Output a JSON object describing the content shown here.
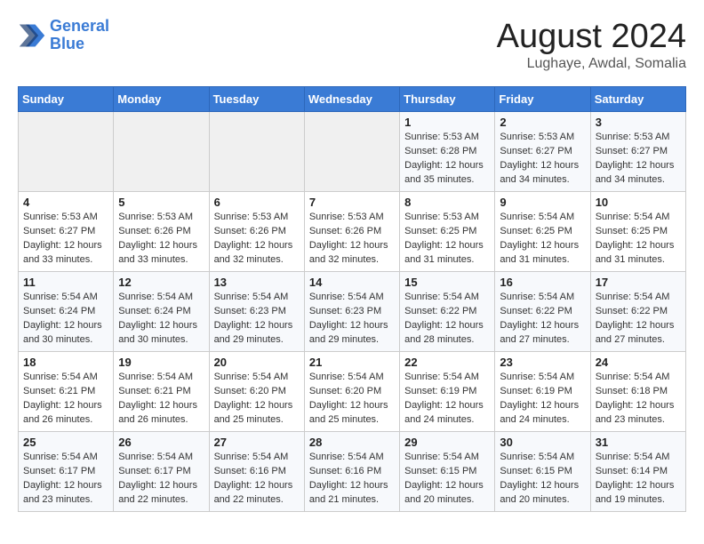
{
  "header": {
    "logo_line1": "General",
    "logo_line2": "Blue",
    "month_year": "August 2024",
    "location": "Lughaye, Awdal, Somalia"
  },
  "days_of_week": [
    "Sunday",
    "Monday",
    "Tuesday",
    "Wednesday",
    "Thursday",
    "Friday",
    "Saturday"
  ],
  "weeks": [
    [
      {
        "day": "",
        "info": ""
      },
      {
        "day": "",
        "info": ""
      },
      {
        "day": "",
        "info": ""
      },
      {
        "day": "",
        "info": ""
      },
      {
        "day": "1",
        "info": "Sunrise: 5:53 AM\nSunset: 6:28 PM\nDaylight: 12 hours\nand 35 minutes."
      },
      {
        "day": "2",
        "info": "Sunrise: 5:53 AM\nSunset: 6:27 PM\nDaylight: 12 hours\nand 34 minutes."
      },
      {
        "day": "3",
        "info": "Sunrise: 5:53 AM\nSunset: 6:27 PM\nDaylight: 12 hours\nand 34 minutes."
      }
    ],
    [
      {
        "day": "4",
        "info": "Sunrise: 5:53 AM\nSunset: 6:27 PM\nDaylight: 12 hours\nand 33 minutes."
      },
      {
        "day": "5",
        "info": "Sunrise: 5:53 AM\nSunset: 6:26 PM\nDaylight: 12 hours\nand 33 minutes."
      },
      {
        "day": "6",
        "info": "Sunrise: 5:53 AM\nSunset: 6:26 PM\nDaylight: 12 hours\nand 32 minutes."
      },
      {
        "day": "7",
        "info": "Sunrise: 5:53 AM\nSunset: 6:26 PM\nDaylight: 12 hours\nand 32 minutes."
      },
      {
        "day": "8",
        "info": "Sunrise: 5:53 AM\nSunset: 6:25 PM\nDaylight: 12 hours\nand 31 minutes."
      },
      {
        "day": "9",
        "info": "Sunrise: 5:54 AM\nSunset: 6:25 PM\nDaylight: 12 hours\nand 31 minutes."
      },
      {
        "day": "10",
        "info": "Sunrise: 5:54 AM\nSunset: 6:25 PM\nDaylight: 12 hours\nand 31 minutes."
      }
    ],
    [
      {
        "day": "11",
        "info": "Sunrise: 5:54 AM\nSunset: 6:24 PM\nDaylight: 12 hours\nand 30 minutes."
      },
      {
        "day": "12",
        "info": "Sunrise: 5:54 AM\nSunset: 6:24 PM\nDaylight: 12 hours\nand 30 minutes."
      },
      {
        "day": "13",
        "info": "Sunrise: 5:54 AM\nSunset: 6:23 PM\nDaylight: 12 hours\nand 29 minutes."
      },
      {
        "day": "14",
        "info": "Sunrise: 5:54 AM\nSunset: 6:23 PM\nDaylight: 12 hours\nand 29 minutes."
      },
      {
        "day": "15",
        "info": "Sunrise: 5:54 AM\nSunset: 6:22 PM\nDaylight: 12 hours\nand 28 minutes."
      },
      {
        "day": "16",
        "info": "Sunrise: 5:54 AM\nSunset: 6:22 PM\nDaylight: 12 hours\nand 27 minutes."
      },
      {
        "day": "17",
        "info": "Sunrise: 5:54 AM\nSunset: 6:22 PM\nDaylight: 12 hours\nand 27 minutes."
      }
    ],
    [
      {
        "day": "18",
        "info": "Sunrise: 5:54 AM\nSunset: 6:21 PM\nDaylight: 12 hours\nand 26 minutes."
      },
      {
        "day": "19",
        "info": "Sunrise: 5:54 AM\nSunset: 6:21 PM\nDaylight: 12 hours\nand 26 minutes."
      },
      {
        "day": "20",
        "info": "Sunrise: 5:54 AM\nSunset: 6:20 PM\nDaylight: 12 hours\nand 25 minutes."
      },
      {
        "day": "21",
        "info": "Sunrise: 5:54 AM\nSunset: 6:20 PM\nDaylight: 12 hours\nand 25 minutes."
      },
      {
        "day": "22",
        "info": "Sunrise: 5:54 AM\nSunset: 6:19 PM\nDaylight: 12 hours\nand 24 minutes."
      },
      {
        "day": "23",
        "info": "Sunrise: 5:54 AM\nSunset: 6:19 PM\nDaylight: 12 hours\nand 24 minutes."
      },
      {
        "day": "24",
        "info": "Sunrise: 5:54 AM\nSunset: 6:18 PM\nDaylight: 12 hours\nand 23 minutes."
      }
    ],
    [
      {
        "day": "25",
        "info": "Sunrise: 5:54 AM\nSunset: 6:17 PM\nDaylight: 12 hours\nand 23 minutes."
      },
      {
        "day": "26",
        "info": "Sunrise: 5:54 AM\nSunset: 6:17 PM\nDaylight: 12 hours\nand 22 minutes."
      },
      {
        "day": "27",
        "info": "Sunrise: 5:54 AM\nSunset: 6:16 PM\nDaylight: 12 hours\nand 22 minutes."
      },
      {
        "day": "28",
        "info": "Sunrise: 5:54 AM\nSunset: 6:16 PM\nDaylight: 12 hours\nand 21 minutes."
      },
      {
        "day": "29",
        "info": "Sunrise: 5:54 AM\nSunset: 6:15 PM\nDaylight: 12 hours\nand 20 minutes."
      },
      {
        "day": "30",
        "info": "Sunrise: 5:54 AM\nSunset: 6:15 PM\nDaylight: 12 hours\nand 20 minutes."
      },
      {
        "day": "31",
        "info": "Sunrise: 5:54 AM\nSunset: 6:14 PM\nDaylight: 12 hours\nand 19 minutes."
      }
    ]
  ]
}
